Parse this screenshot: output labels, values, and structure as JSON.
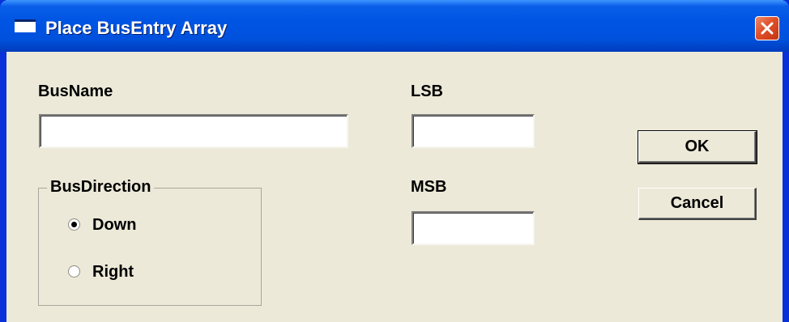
{
  "window": {
    "title": "Place BusEntry Array",
    "title_icon": "window-icon",
    "close_icon": "close-icon"
  },
  "form": {
    "busname": {
      "label": "BusName",
      "value": ""
    },
    "lsb": {
      "label": "LSB",
      "value": ""
    },
    "msb": {
      "label": "MSB",
      "value": ""
    },
    "bus_direction": {
      "title": "BusDirection",
      "options": [
        {
          "label": "Down",
          "selected": true
        },
        {
          "label": "Right",
          "selected": false
        }
      ]
    }
  },
  "buttons": {
    "ok_label": "OK",
    "cancel_label": "Cancel"
  },
  "colors": {
    "titlebar": "#0054e3",
    "dialog_background": "#ece9d8",
    "close_button": "#e0502b"
  }
}
